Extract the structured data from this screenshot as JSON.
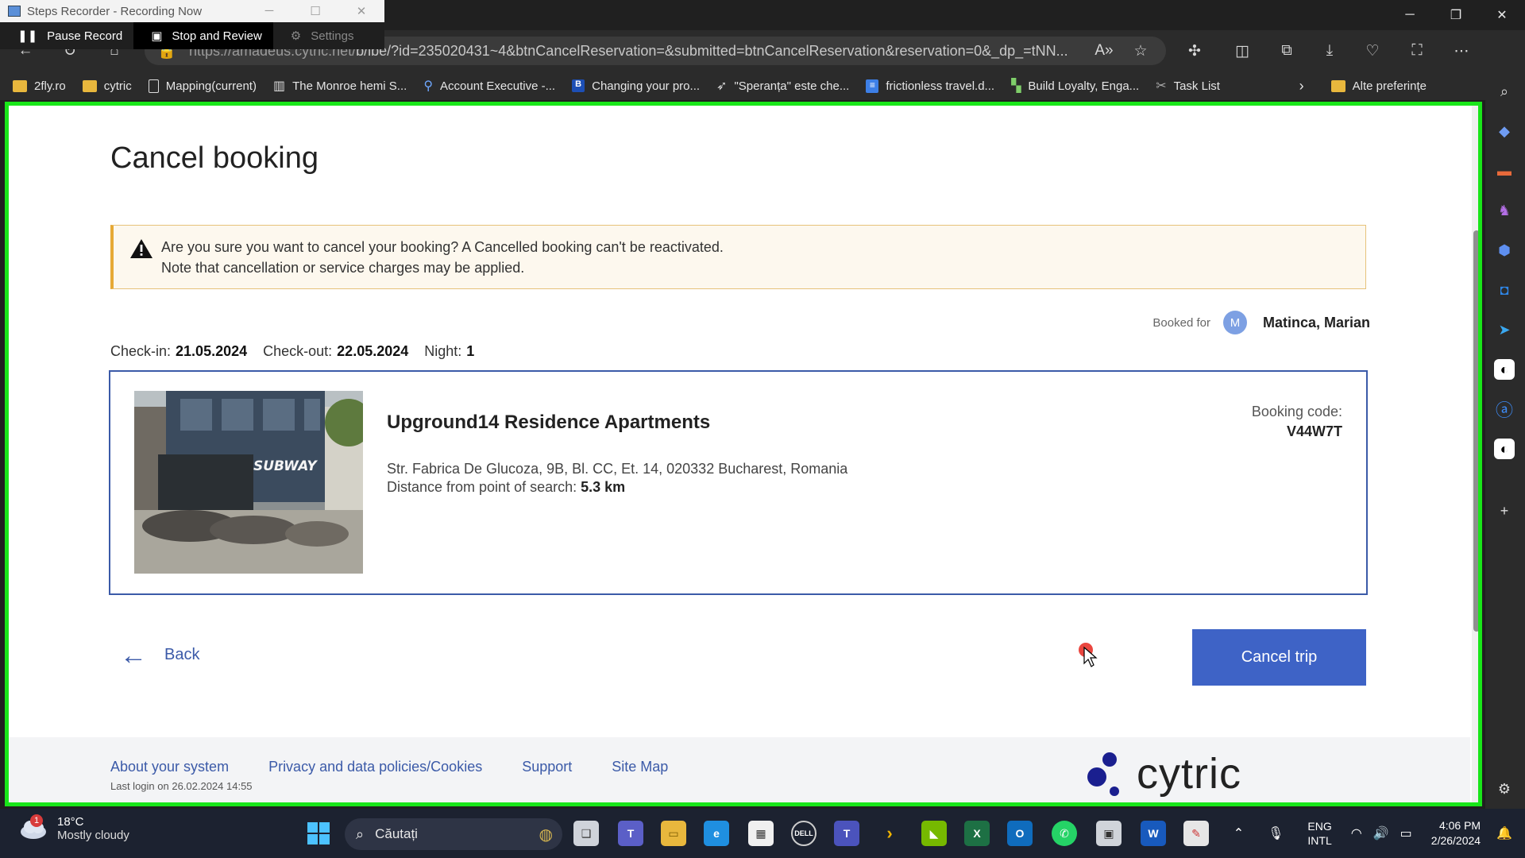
{
  "steps_recorder": {
    "title": "Steps Recorder - Recording Now",
    "pause_label": "Pause Record",
    "stop_label": "Stop and Review",
    "settings_label": "Settings"
  },
  "browser": {
    "url_prefix": "https://amadeus.cytric.net/",
    "url_main": "b/ibe/?id=235020431~4&btnCancelReservation=&submitted=btnCancelReservation&reservation=0&_dp_=tNN...",
    "bookmarks": [
      {
        "label": "2fly.ro",
        "icon": "folder-icon"
      },
      {
        "label": "cytric",
        "icon": "folder-icon"
      },
      {
        "label": "Mapping(current)",
        "icon": "page-icon"
      },
      {
        "label": "The Monroe hemi S...",
        "icon": "building-icon"
      },
      {
        "label": "Account Executive -...",
        "icon": "link-icon"
      },
      {
        "label": "Changing your pro...",
        "icon": "b-icon"
      },
      {
        "label": "\"Speranța\" este che...",
        "icon": "bird-icon"
      },
      {
        "label": "frictionless travel.d...",
        "icon": "doc-icon"
      },
      {
        "label": "Build Loyalty, Enga...",
        "icon": "chart-icon"
      },
      {
        "label": "Task List",
        "icon": "tools-icon"
      }
    ],
    "other_bookmarks": "Alte preferințe"
  },
  "page": {
    "title": "Cancel booking",
    "warning_line1": "Are you sure you want to cancel your booking? A Cancelled booking can't be reactivated.",
    "warning_line2": "Note that cancellation or service charges may be applied.",
    "booked_for_label": "Booked for",
    "avatar_initial": "M",
    "traveler_name": "Matinca, Marian",
    "checkin_label": "Check-in:",
    "checkin_value": "21.05.2024",
    "checkout_label": "Check-out:",
    "checkout_value": "22.05.2024",
    "night_label": "Night:",
    "night_value": "1",
    "hotel": {
      "name": "Upground14 Residence Apartments",
      "address": "Str. Fabrica De Glucoza, 9B, Bl. CC, Et. 14, 020332 Bucharest, Romania",
      "distance_label": "Distance from point of search:",
      "distance_value": "5.3 km",
      "booking_code_label": "Booking code:",
      "booking_code": "V44W7T",
      "photo_sign": "SUBWAY"
    },
    "back_label": "Back",
    "cancel_trip_label": "Cancel trip",
    "footer": {
      "links": [
        "About your system",
        "Privacy and data policies/Cookies",
        "Support",
        "Site Map"
      ],
      "last_login": "Last login on 26.02.2024 14:55",
      "brand": "cytric"
    }
  },
  "taskbar": {
    "weather_badge": "1",
    "temperature": "18°C",
    "weather_text": "Mostly cloudy",
    "search_placeholder": "Căutați",
    "lang_line1": "ENG",
    "lang_line2": "INTL",
    "time": "4:06 PM",
    "date": "2/26/2024"
  },
  "colors": {
    "accent": "#3e63c6",
    "link": "#3b5aa8",
    "recording_border": "#19e619",
    "warning_border": "#e6a935"
  }
}
